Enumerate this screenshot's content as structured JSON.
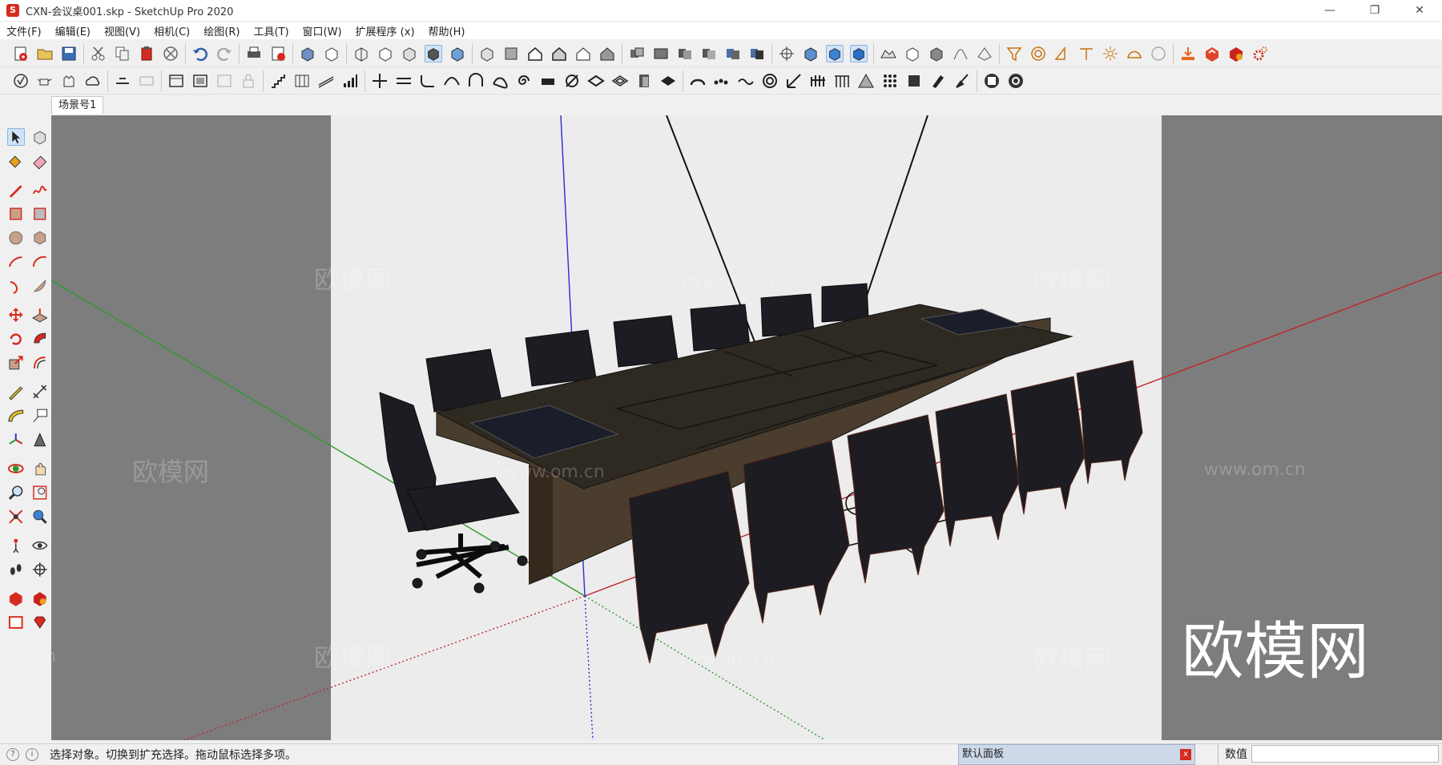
{
  "window": {
    "title": "CXN-会议桌001.skp - SketchUp Pro 2020",
    "app_icon_glyph": "S",
    "controls": {
      "minimize": "—",
      "restore": "❐",
      "close": "✕"
    }
  },
  "menu": [
    "文件(F)",
    "编辑(E)",
    "视图(V)",
    "相机(C)",
    "绘图(R)",
    "工具(T)",
    "窗口(W)",
    "扩展程序 (x)",
    "帮助(H)"
  ],
  "scene_tab": "场景号1",
  "watermark": {
    "brand": "欧模网",
    "url": "www.om.cn",
    "tail": "om.cn"
  },
  "status": {
    "info_icon_1": "?",
    "info_icon_2": "i",
    "message": "选择对象。切换到扩充选择。拖动鼠标选择多项。",
    "panel_label": "默认面板",
    "panel_close": "x",
    "measure_label": "数值"
  },
  "colors": {
    "model_bg": "#ececec",
    "viewport_bg": "#7d7d7d",
    "axis_red": "#c0262c",
    "axis_green": "#2d9a2d",
    "axis_blue": "#2b2bd2",
    "table_top": "#2e2a22",
    "table_side": "#4a3d2d",
    "chair": "#1c1c22",
    "accent_red": "#d52b1e"
  }
}
